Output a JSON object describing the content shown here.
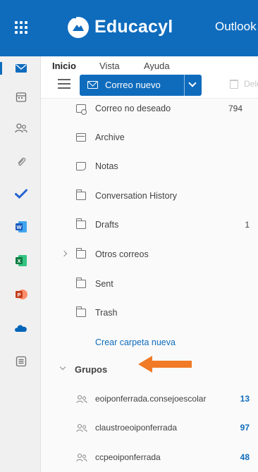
{
  "header": {
    "brand": "Educacyl",
    "app_name": "Outlook",
    "background": "#0f6cbd"
  },
  "rail": {
    "apps": [
      {
        "name": "mail-icon",
        "active": true
      },
      {
        "name": "calendar-icon"
      },
      {
        "name": "people-icon"
      },
      {
        "name": "attachment-icon"
      },
      {
        "name": "todo-icon"
      },
      {
        "name": "word-icon"
      },
      {
        "name": "excel-icon"
      },
      {
        "name": "powerpoint-icon"
      },
      {
        "name": "onedrive-icon"
      },
      {
        "name": "apps-icon"
      }
    ]
  },
  "ribbon": {
    "tabs": [
      {
        "label": "Inicio",
        "active": true
      },
      {
        "label": "Vista"
      },
      {
        "label": "Ayuda"
      }
    ],
    "new_mail_label": "Correo nuevo",
    "ghost_label": "Dele"
  },
  "folders": [
    {
      "label": "Correo no deseado",
      "icon": "junk-folder-icon",
      "count": "794"
    },
    {
      "label": "Archive",
      "icon": "archive-icon",
      "count": ""
    },
    {
      "label": "Notas",
      "icon": "notes-icon",
      "count": ""
    },
    {
      "label": "Conversation History",
      "icon": "folder-icon",
      "count": ""
    },
    {
      "label": "Drafts",
      "icon": "folder-icon",
      "count": "1"
    },
    {
      "label": "Otros correos",
      "icon": "folder-icon",
      "count": "",
      "expandable": true
    },
    {
      "label": "Sent",
      "icon": "folder-icon",
      "count": ""
    },
    {
      "label": "Trash",
      "icon": "folder-icon",
      "count": ""
    }
  ],
  "new_folder_label": "Crear carpeta nueva",
  "groups_header": "Grupos",
  "groups": [
    {
      "label": "eoiponferrada.consejoescolar",
      "count": "13"
    },
    {
      "label": "claustroeoiponferrada",
      "count": "97"
    },
    {
      "label": "ccpeoiponferrada",
      "count": "48"
    }
  ],
  "annotation_arrow_color": "#f07a26"
}
